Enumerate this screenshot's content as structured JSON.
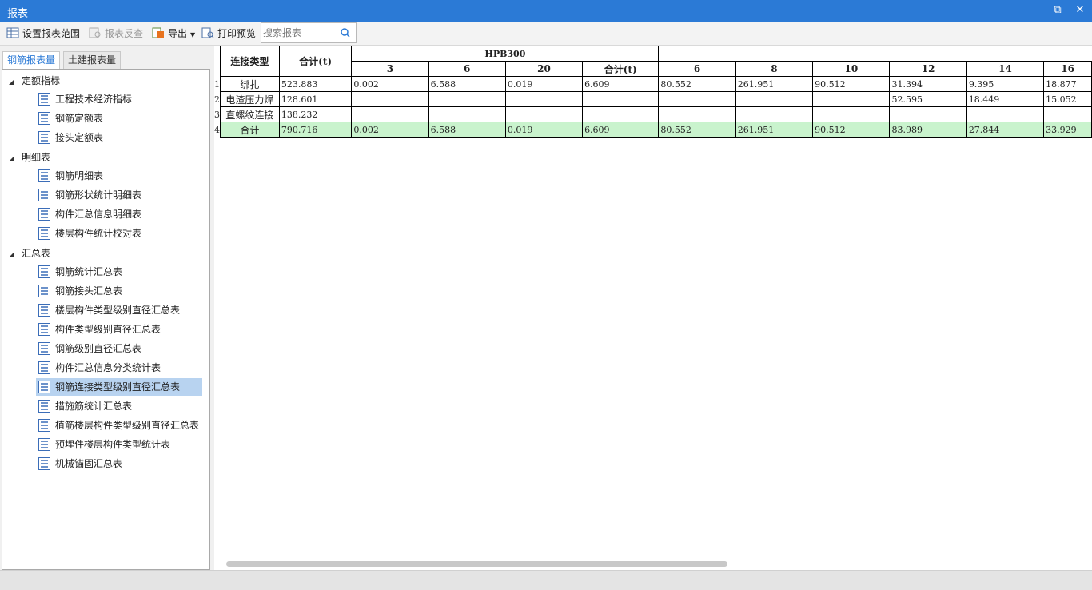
{
  "window": {
    "title": "报表"
  },
  "toolbar": {
    "set_range": "设置报表范围",
    "reverse_check": "报表反查",
    "export": "导出",
    "print_preview": "打印预览",
    "search_placeholder": "搜索报表"
  },
  "tabs": {
    "rebar": "钢筋报表量",
    "civil": "土建报表量"
  },
  "tree": {
    "groups": [
      {
        "label": "定额指标",
        "items": [
          "工程技术经济指标",
          "钢筋定额表",
          "接头定额表"
        ]
      },
      {
        "label": "明细表",
        "items": [
          "钢筋明细表",
          "钢筋形状统计明细表",
          "构件汇总信息明细表",
          "楼层构件统计校对表"
        ]
      },
      {
        "label": "汇总表",
        "items": [
          "钢筋统计汇总表",
          "钢筋接头汇总表",
          "楼层构件类型级别直径汇总表",
          "构件类型级别直径汇总表",
          "钢筋级别直径汇总表",
          "构件汇总信息分类统计表",
          "钢筋连接类型级别直径汇总表",
          "措施筋统计汇总表",
          "植筋楼层构件类型级别直径汇总表",
          "预埋件楼层构件类型统计表",
          "机械锚固汇总表"
        ]
      }
    ],
    "selected": "钢筋连接类型级别直径汇总表"
  },
  "table": {
    "h_conn_type": "连接类型",
    "h_total": "合计(t)",
    "h_group": "HPB300",
    "h_sub": [
      "3",
      "6",
      "20",
      "合计(t)",
      "6",
      "8",
      "10",
      "12",
      "14",
      "16"
    ],
    "rows": [
      {
        "num": "1",
        "type": "绑扎",
        "total": "523.883",
        "cells": [
          "0.002",
          "6.588",
          "0.019",
          "6.609",
          "80.552",
          "261.951",
          "90.512",
          "31.394",
          "9.395",
          "18.877"
        ]
      },
      {
        "num": "2",
        "type": "电渣压力焊",
        "total": "128.601",
        "cells": [
          "",
          "",
          "",
          "",
          "",
          "",
          "",
          "52.595",
          "18.449",
          "15.052"
        ]
      },
      {
        "num": "3",
        "type": "直螺纹连接",
        "total": "138.232",
        "cells": [
          "",
          "",
          "",
          "",
          "",
          "",
          "",
          "",
          "",
          ""
        ]
      },
      {
        "num": "4",
        "type": "合计",
        "total": "790.716",
        "cells": [
          "0.002",
          "6.588",
          "0.019",
          "6.609",
          "80.552",
          "261.951",
          "90.512",
          "83.989",
          "27.844",
          "33.929"
        ]
      }
    ]
  },
  "colors": {
    "titlebar": "#2b7ad6",
    "selection": "#b8d3f0",
    "total_row": "#c9f3cd"
  }
}
